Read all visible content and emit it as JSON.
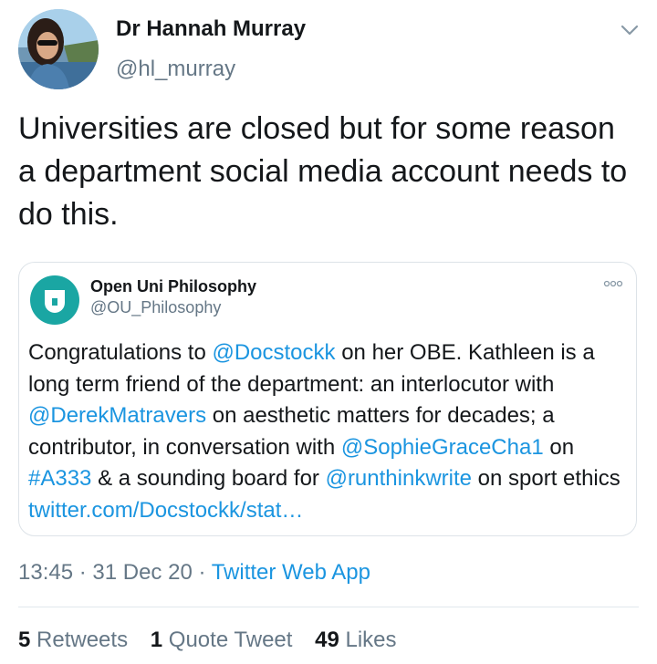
{
  "tweet": {
    "author_name": "Dr Hannah Murray",
    "author_handle": "@hl_murray",
    "text": "Universities are closed but for some reason a department social media account needs to do this.",
    "timestamp": "13:45 · 31 Dec 20 · ",
    "source_app": "Twitter Web App"
  },
  "quoted_tweet": {
    "author_name": "Open Uni Philosophy",
    "author_handle": "@OU_Philosophy",
    "segments": [
      {
        "text": "Congratulations to ",
        "link": false
      },
      {
        "text": "@Docstockk",
        "link": true
      },
      {
        "text": " on her OBE.  Kathleen is a long term friend of the department: an interlocutor with ",
        "link": false
      },
      {
        "text": "@DerekMatravers",
        "link": true
      },
      {
        "text": " on aesthetic matters for decades; a contributor, in conversation with ",
        "link": false
      },
      {
        "text": "@SophieGraceCha1",
        "link": true
      },
      {
        "text": " on ",
        "link": false
      },
      {
        "text": "#A333",
        "link": true
      },
      {
        "text": " & a sounding board for ",
        "link": false
      },
      {
        "text": "@runthinkwrite",
        "link": true
      },
      {
        "text": " on sport ethics ",
        "link": false
      },
      {
        "text": "twitter.com/Docstockk/stat…",
        "link": true
      }
    ]
  },
  "stats": {
    "retweets_count": "5",
    "retweets_label": "Retweets",
    "quotes_count": "1",
    "quotes_label": "Quote Tweet",
    "likes_count": "49",
    "likes_label": "Likes"
  },
  "colors": {
    "link": "#1b95e0",
    "secondary_text": "#657786",
    "ou_brand": "#1aa6a3"
  },
  "icons": {
    "menu": "chevron-down-icon",
    "quote_menu": "more-horizontal-icon",
    "ou_logo": "open-university-logo"
  }
}
